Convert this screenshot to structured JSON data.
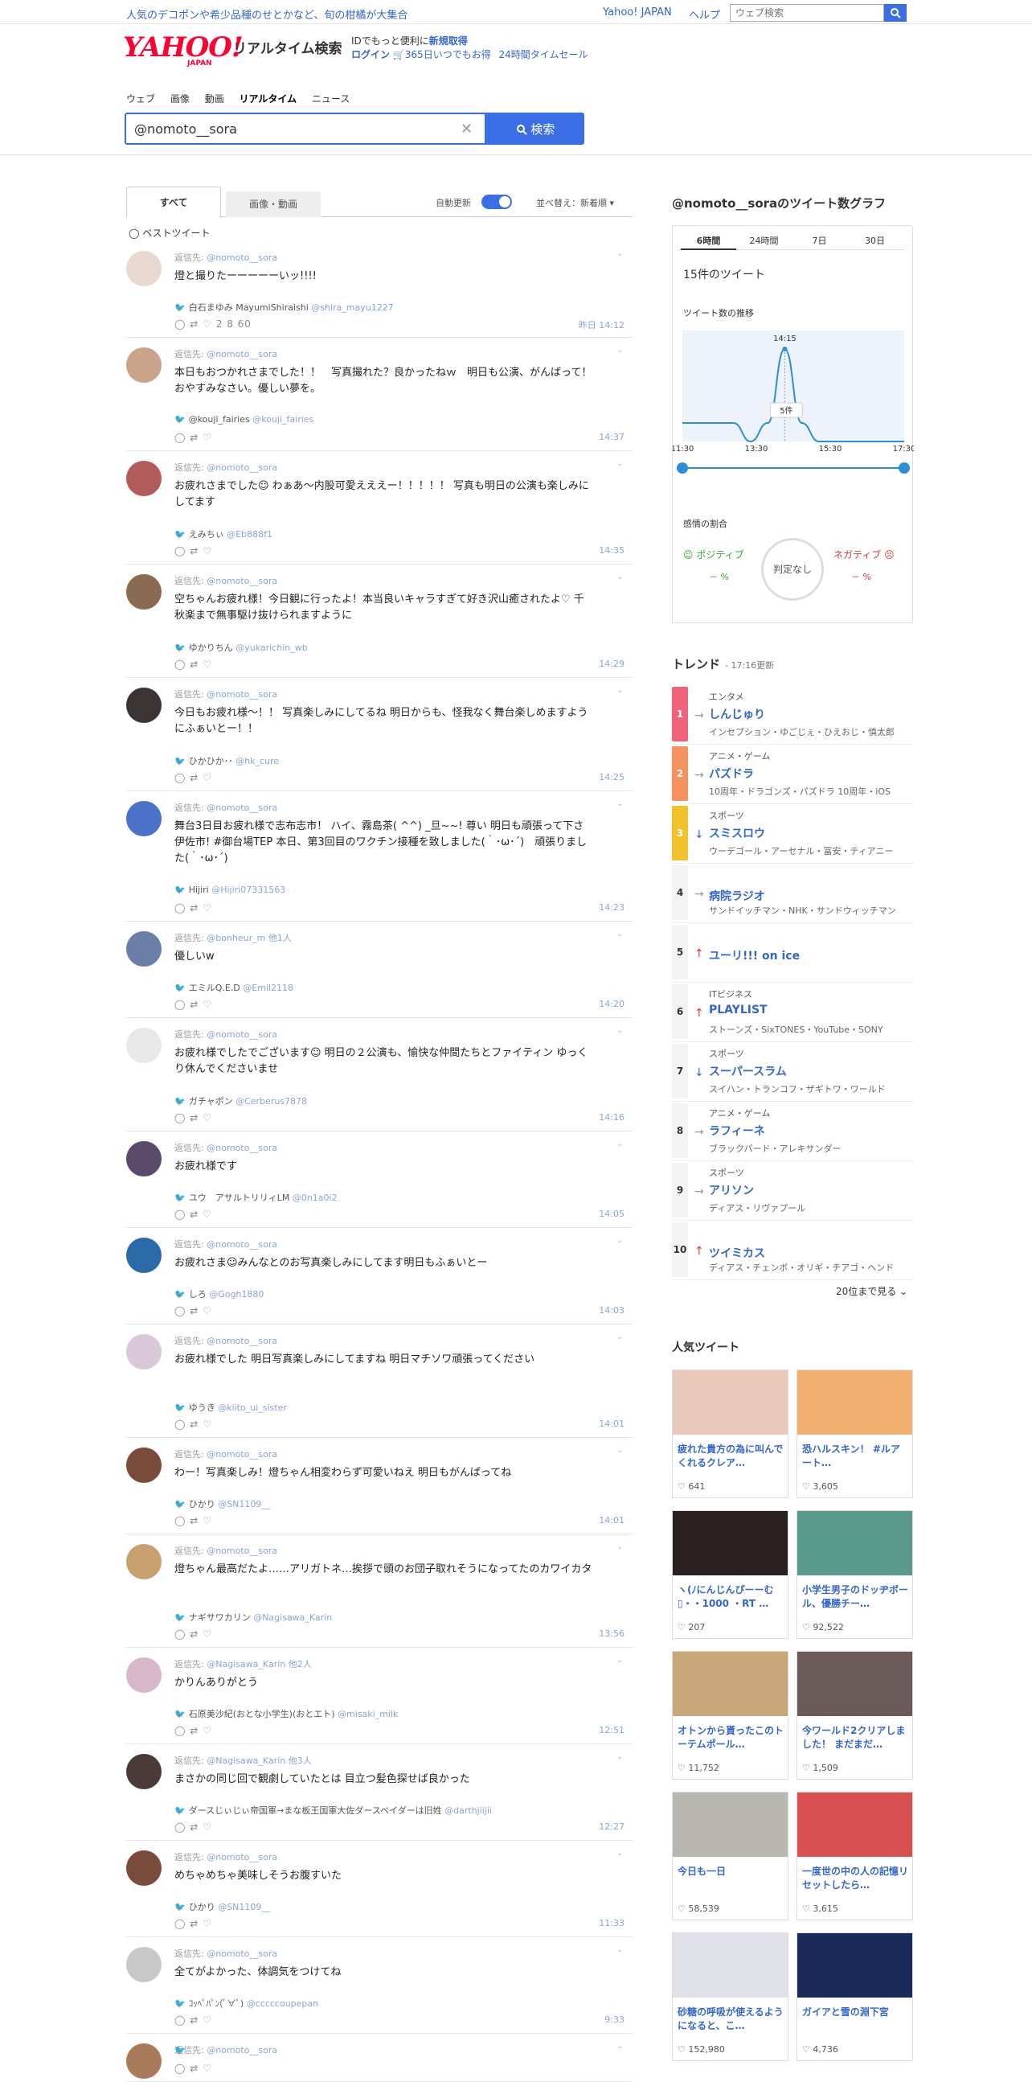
{
  "topbar": {
    "promo": "人気のデコポンや希少品種のせとかなど、旬の柑橘が大集合",
    "yahoo_japan": "Yahoo! JAPAN",
    "help": "ヘルプ",
    "site_search_placeholder": "ウェブ検索"
  },
  "header": {
    "logo_text": "YAHOO!",
    "logo_sub": "JAPAN",
    "service": "リアルタイム検索",
    "id_line1": "IDでもっと便利に",
    "id_new": "新規取得",
    "login": "ログイン",
    "deal": "🛒365日いつでもお得",
    "timesale": "24時間タイムセール"
  },
  "nav": [
    "ウェブ",
    "画像",
    "動画",
    "リアルタイム",
    "ニュース"
  ],
  "search": {
    "query": "@nomoto__sora",
    "button": "検索"
  },
  "tabs": {
    "all": "すべて",
    "media": "画像・動画",
    "auto": "自動更新",
    "sort": "並べ替え：新着順 ▾",
    "best": "ベストツイート"
  },
  "tweets": [
    {
      "reply": "返信先:",
      "to": "@nomoto__sora",
      "text": "燈と撮りたーーーーーいッ!!!!",
      "name": "白石まゆみ MayumiShiraishi",
      "handle": "@shira_mayu1227",
      "acts": "2  8  60",
      "time": "昨日 14:12",
      "color": "#e9d8d0"
    },
    {
      "reply": "返信先:",
      "to": "@nomoto__sora",
      "text": "本日もおつかれさまでした！！　写真撮れた？良かったねｗ　明日も公演、がんばって！　おやすみなさい。優しい夢を。",
      "name": "@kouji_fairies",
      "handle": "@kouji_fairies",
      "acts": "",
      "time": "14:37",
      "color": "#c9a38a"
    },
    {
      "reply": "返信先:",
      "to": "@nomoto__sora",
      "text": "お疲れさまでした☺ わぁあ〜内股可愛えええー！！！！！ 写真も明日の公演も楽しみにしてます",
      "name": "えみちぃ",
      "handle": "@Eb888f1",
      "acts": "",
      "time": "14:35",
      "color": "#b35b5b"
    },
    {
      "reply": "返信先:",
      "to": "@nomoto__sora",
      "text": "空ちゃんお疲れ様！今日観に行ったよ！本当良いキャラすぎて好き沢山癒されたよ♡ 千秋楽まで無事駆け抜けられますように",
      "name": "ゆかりちん",
      "handle": "@yukarichin_wb",
      "acts": "",
      "time": "14:29",
      "color": "#8a6a52"
    },
    {
      "reply": "返信先:",
      "to": "@nomoto__sora",
      "text": "今日もお疲れ様〜！！ 写真楽しみにしてるね 明日からも、怪我なく舞台楽しめますようにふぁいとー！！",
      "name": "ひかひか･･",
      "handle": "@hk_cure",
      "acts": "",
      "time": "14:25",
      "color": "#3a3434"
    },
    {
      "reply": "返信先:",
      "to": "@nomoto__sora",
      "text": "舞台3日目お疲れ様で志布志市！ ハイ、霧島茶( ^^) _旦~~! 尊い 明日も頑張って下さ伊佐市! #御台場TEP 本日、第3回目のワクチン接種を致しました(｀･ω･´)　頑張りました(｀･ω･´)",
      "name": "Hijiri",
      "handle": "@Hijiri07331563",
      "acts": "",
      "time": "14:23",
      "color": "#4a72c8"
    },
    {
      "reply": "返信先:",
      "to": "@bonheur_m 他1人",
      "text": "優しいw",
      "name": "エミルQ.E.D",
      "handle": "@Emil2118",
      "acts": "",
      "time": "14:20",
      "color": "#6a7fa8"
    },
    {
      "reply": "返信先:",
      "to": "@nomoto__sora",
      "text": "お疲れ様でしたでございます☺ 明日の２公演も、愉快な仲間たちとファイティン ゆっくり休んでくださいませ",
      "name": "ガチャポン",
      "handle": "@Cerberus7878",
      "acts": "",
      "time": "14:16",
      "color": "#e8e8e8"
    },
    {
      "reply": "返信先:",
      "to": "@nomoto__sora",
      "text": "お疲れ様です",
      "name": "ユウ　アサルトリリィLM",
      "handle": "@0n1a0i2",
      "acts": "",
      "time": "14:05",
      "color": "#5a4a6a"
    },
    {
      "reply": "返信先:",
      "to": "@nomoto__sora",
      "text": "お疲れさま☺みんなとのお写真楽しみにしてます明日もふぁいとー",
      "name": "しろ",
      "handle": "@Gogh1880",
      "acts": "",
      "time": "14:03",
      "color": "#2a6aa8"
    },
    {
      "reply": "返信先:",
      "to": "@nomoto__sora",
      "text": "お疲れ様でした 明日写真楽しみにしてますね 明日マチソワ頑張ってください",
      "name": "ゆうき",
      "handle": "@kiito_ui_sister",
      "acts": "",
      "time": "14:01",
      "color": "#d8c8d8"
    },
    {
      "reply": "返信先:",
      "to": "@nomoto__sora",
      "text": "わー！写真楽しみ！燈ちゃん相変わらず可愛いねえ 明日もがんばってね",
      "name": "ひかり",
      "handle": "@SN1109__",
      "acts": "",
      "time": "14:01",
      "color": "#7a4a3a"
    },
    {
      "reply": "返信先:",
      "to": "@nomoto__sora",
      "text": "燈ちゃん最高だたよ……アリガトネ…挨拶で頭のお団子取れそうになってたのカワイカタ",
      "name": "ナギサワカリン",
      "handle": "@Nagisawa_Karin",
      "acts": "",
      "time": "13:56",
      "color": "#c8a070"
    },
    {
      "reply": "返信先:",
      "to": "@Nagisawa_Karin 他2人",
      "text": "かりんありがとう",
      "name": "石原美沙紀(おとな小学生)(おとエト)",
      "handle": "@misaki_milk",
      "acts": "",
      "time": "12:51",
      "color": "#d8b8c8"
    },
    {
      "reply": "返信先:",
      "to": "@Nagisawa_Karin 他3人",
      "text": "まさかの同じ回で観劇していたとは 目立つ髪色探せば良かった",
      "name": "ダースじぃじぃ帝国軍→まな板王国軍大佐ダースベイダーは旧姓",
      "handle": "@darthjiijii",
      "acts": "",
      "time": "12:27",
      "color": "#4a3a3a"
    },
    {
      "reply": "返信先:",
      "to": "@nomoto__sora",
      "text": "めちゃめちゃ美味しそうお腹すいた",
      "name": "ひかり",
      "handle": "@SN1109__",
      "acts": "",
      "time": "11:33",
      "color": "#7a4a3a"
    },
    {
      "reply": "返信先:",
      "to": "@nomoto__sora",
      "text": "全てがよかった、体調気をつけてね",
      "name": "ｺｯﾍﾟﾊﾟﾝ(ﾟ∀ﾟ)",
      "handle": "@cccccoupepan",
      "acts": "",
      "time": "9:33",
      "color": "#c8c8c8"
    },
    {
      "reply": "返信先:",
      "to": "@nomoto__sora",
      "text": "",
      "name": "",
      "handle": "",
      "acts": "",
      "time": "",
      "color": "#a87a5a"
    }
  ],
  "graph": {
    "title": "@nomoto__soraのツイート数グラフ",
    "periods": [
      "6時間",
      "24時間",
      "7日",
      "30日"
    ],
    "count": "15件のツイート",
    "trend_label": "ツイート数の推移",
    "peak_time": "14:15",
    "peak_count": "5件",
    "emotion_title": "感情の割合",
    "positive": "ポジティブ",
    "negative": "ネガティブ",
    "pos_pct": "－ %",
    "neg_pct": "－ %",
    "judge": "判定なし"
  },
  "chart_data": {
    "type": "line",
    "x": [
      "11:30",
      "12:00",
      "12:30",
      "13:00",
      "13:30",
      "14:00",
      "14:15",
      "14:30",
      "15:00",
      "15:30",
      "16:00",
      "16:30",
      "17:00",
      "17:30"
    ],
    "values": [
      1,
      1,
      1,
      1,
      0,
      1,
      5,
      1,
      0,
      0,
      0,
      0,
      0,
      0
    ],
    "tick_labels": [
      "11:30",
      "13:30",
      "15:30",
      "17:30"
    ],
    "color": "#2a8fd6"
  },
  "trend_head": {
    "title": "トレンド",
    "updated": "17:16更新"
  },
  "trends": [
    {
      "rank": "1",
      "color": "#f06277",
      "arrow": "→",
      "cat": "エンタメ",
      "word": "しんじゅり",
      "sub": "インセプション・ゆごじぇ・ひえおじ・慎太郎"
    },
    {
      "rank": "2",
      "color": "#f5925d",
      "arrow": "→",
      "cat": "アニメ・ゲーム",
      "word": "パズドラ",
      "sub": "10周年・ドラゴンズ・パズドラ 10周年・iOS"
    },
    {
      "rank": "3",
      "color": "#f2c12e",
      "arrow": "↓",
      "cat": "スポーツ",
      "word": "スミスロウ",
      "sub": "ウーデゴール・アーセナル・冨安・ティアニー"
    },
    {
      "rank": "4",
      "color": "",
      "arrow": "→",
      "cat": "",
      "word": "病院ラジオ",
      "sub": "サンドイッチマン・NHK・サンドウィッチマン"
    },
    {
      "rank": "5",
      "color": "",
      "arrow": "↑",
      "cat": "",
      "word": "ユーリ!!! on ice",
      "sub": ""
    },
    {
      "rank": "6",
      "color": "",
      "arrow": "↑",
      "cat": "ITビジネス",
      "word": "PLAYLIST",
      "sub": "ストーンズ・SixTONES・YouTube・SONY"
    },
    {
      "rank": "7",
      "color": "",
      "arrow": "↓",
      "cat": "スポーツ",
      "word": "スーパースラム",
      "sub": "スイハン・トランコフ・ザギトワ・ワールド"
    },
    {
      "rank": "8",
      "color": "",
      "arrow": "→",
      "cat": "アニメ・ゲーム",
      "word": "ラフィーネ",
      "sub": "ブラックパード・アレキサンダー"
    },
    {
      "rank": "9",
      "color": "",
      "arrow": "→",
      "cat": "スポーツ",
      "word": "アリソン",
      "sub": "ディアス・リヴァプール"
    },
    {
      "rank": "10",
      "color": "",
      "arrow": "↑",
      "cat": "",
      "word": "ツイミカス",
      "sub": "ディアス・チェンボ・オリギ・チアゴ・ヘンド"
    }
  ],
  "more": "20位まで見る ⌄",
  "popular_head": "人気ツイート",
  "popular": [
    {
      "title": "疲れた貴方の為に叫んでくれるクレア…",
      "likes": "♡ 641",
      "color": "#e8c8b8"
    },
    {
      "title": "恐ハルスキン！ #ルアート…",
      "likes": "♡ 3,605",
      "color": "#f0b070"
    },
    {
      "title": "ヽ(ﾉにんじんぴーーむ ︎▯・・1000︎ ・RT …",
      "likes": "♡ 207",
      "color": "#2a2020"
    },
    {
      "title": "小学生男子のドッヂボール、優勝チー…",
      "likes": "♡ 92,522",
      "color": "#5a9a8a"
    },
    {
      "title": "オトンから貰ったこのトーテムポール…",
      "likes": "♡ 11,752",
      "color": "#c8a878"
    },
    {
      "title": "今ワールド2クリアしました！ まだまだ…",
      "likes": "♡ 1,509",
      "color": "#6a5a5a"
    },
    {
      "title": "今日も一日",
      "likes": "♡ 58,539",
      "color": "#b8b8b0"
    },
    {
      "title": "一度世の中の人の記憶リセットしたら…",
      "likes": "♡ 3,615",
      "color": "#d85050"
    },
    {
      "title": "砂糖の呼吸が使えるようになると、こ…",
      "likes": "♡ 152,980",
      "color": "#e0e0e8"
    },
    {
      "title": "ガイアと雪の淵下宮",
      "likes": "♡ 4,736",
      "color": "#1a2a5a"
    }
  ]
}
